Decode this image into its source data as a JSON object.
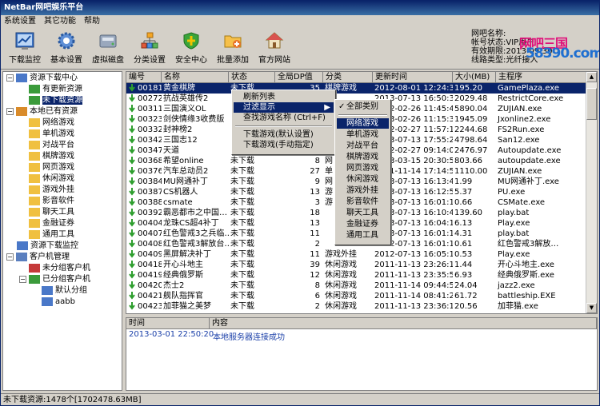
{
  "title": "NetBar网吧娱乐平台",
  "menu": [
    "系统设置",
    "其它功能",
    "帮助"
  ],
  "toolbar": [
    {
      "label": "下载监控",
      "icon": "chart-icon"
    },
    {
      "label": "基本设置",
      "icon": "gear-icon"
    },
    {
      "label": "虚拟磁盘",
      "icon": "disk-icon"
    },
    {
      "label": "分类设置",
      "icon": "category-icon"
    },
    {
      "label": "安全中心",
      "icon": "shield-icon"
    },
    {
      "label": "批量添加",
      "icon": "folder-add-icon"
    },
    {
      "label": "官方网站",
      "icon": "home-icon"
    }
  ],
  "info": {
    "l1": "网吧名称:",
    "l2": "帐号状态:VIP用户",
    "l3": "有效期限:2013-09-30",
    "l4": "线路类型:光纤接入"
  },
  "logo": {
    "l1": "网吧三国",
    "l2": "58390.com"
  },
  "tree": {
    "res_center": "资源下载中心",
    "updated": "有更新资源",
    "not_dl": "未下载资源",
    "local": "本地已有资源",
    "cats": [
      "网络游戏",
      "单机游戏",
      "对战平台",
      "棋牌游戏",
      "网页游戏",
      "休闲游戏",
      "游戏外挂",
      "影音软件",
      "聊天工具",
      "金融证券",
      "通用工具"
    ],
    "dl_monitor": "资源下载监控",
    "client_mgr": "客户机管理",
    "ungrouped": "未分组客户机",
    "grouped": "已分组客户机",
    "default_group": "默认分组",
    "aabb": "aabb"
  },
  "columns": [
    "编号",
    "名称",
    "状态",
    "全局DP值",
    "分类",
    "更新时间",
    "大小(MB)",
    "主程序"
  ],
  "rows": [
    [
      "00181",
      "黄金棋牌",
      "未下载",
      "35",
      "棋牌游戏",
      "2012-08-01 12:24:36",
      "195.20",
      "GamePlaza.exe"
    ],
    [
      "00272",
      "抗战英雄传2",
      "",
      "",
      "",
      "2013-07-13 16:50:30",
      "2029.48",
      "RestrictCore.exe"
    ],
    [
      "00311",
      "三国演义OL",
      "",
      "",
      "",
      "2012-02-26 11:45:41",
      "5890.04",
      "ZUJIAN.exe"
    ],
    [
      "00323",
      "剑侠情缘3收费版",
      "",
      "",
      "",
      "2013-02-26 11:15:38",
      "1945.09",
      "Jxonline2.exe"
    ],
    [
      "00332",
      "封神榜2",
      "",
      "",
      "",
      "2012-02-27 11:57:13",
      "2244.68",
      "FS2Run.exe"
    ],
    [
      "00342",
      "三国志12",
      "",
      "",
      "",
      "2013-07-13 17:55:22",
      "4798.64",
      "San12.exe"
    ],
    [
      "00347",
      "天道",
      "",
      "",
      "",
      "2012-02-27 09:14:02",
      "2476.97",
      "Autoupdate.exe"
    ],
    [
      "00368",
      "希望online",
      "未下载",
      "8",
      "网",
      "2013-03-15 20:30:54",
      "803.66",
      "autoupdate.exe"
    ],
    [
      "00376",
      "汽车总动员2",
      "未下载",
      "27",
      "单",
      "2011-11-14 17:14:56",
      "1110.00",
      "ZUJIAN.exe"
    ],
    [
      "00384",
      "MU网通补丁",
      "未下载",
      "9",
      "网",
      "2013-07-13 16:13:49",
      "1.99",
      "MU网通补丁.exe"
    ],
    [
      "00387",
      "CS机器人",
      "未下载",
      "13",
      "游",
      "2013-07-13 16:12:59",
      "5.37",
      "PU.exe"
    ],
    [
      "00388",
      "csmate",
      "未下载",
      "3",
      "游",
      "2013-07-13 16:01:12",
      "0.66",
      "CSMate.exe"
    ],
    [
      "00392",
      "霸恶都市之中国…",
      "未下载",
      "18",
      "",
      "2013-07-13 16:10:48",
      "139.60",
      "play.bat"
    ],
    [
      "00404",
      "龙珠CS超4补丁",
      "未下载",
      "13",
      "",
      "2013-07-13 16:04:17",
      "6.13",
      "Play.exe"
    ],
    [
      "00407",
      "红色警戒3之兵临…",
      "未下载",
      "11",
      "",
      "2013-07-13 16:01:15",
      "4.31",
      "play.bat"
    ],
    [
      "00408",
      "红色警戒3解放台…",
      "未下载",
      "2",
      "",
      "2012-07-13 16:01:18",
      "0.61",
      "红色警戒3解放…"
    ],
    [
      "00409",
      "黑屏解决补丁",
      "未下载",
      "11",
      "游戏外挂",
      "2012-07-13 16:05:11",
      "0.53",
      "Play.exe"
    ],
    [
      "00418",
      "开心斗地主",
      "未下载",
      "39",
      "休闲游戏",
      "2011-11-13 23:26:18",
      "1.44",
      "开心斗地主.exe"
    ],
    [
      "00419",
      "经典俄罗斯",
      "未下载",
      "12",
      "休闲游戏",
      "2011-11-13 23:35:52",
      "6.93",
      "经典俄罗斯.exe"
    ],
    [
      "00420",
      "杰士2",
      "未下载",
      "8",
      "休闲游戏",
      "2011-11-14 09:44:51",
      "24.04",
      "jazz2.exe"
    ],
    [
      "00421",
      "舰队指挥官",
      "未下载",
      "6",
      "休闲游戏",
      "2011-11-14 08:41:28",
      "61.72",
      "battleship.EXE"
    ],
    [
      "00423",
      "加菲猫之美梦",
      "未下载",
      "2",
      "休闲游戏",
      "2011-11-13 23:36:11",
      "20.56",
      "加菲猫.exe"
    ]
  ],
  "context_menu": [
    "刷新列表",
    "过滤显示",
    "查找游戏名称 (Ctrl+F)",
    "下载游戏(默认设置)",
    "下载游戏(手动指定)"
  ],
  "submenu": [
    "全部类别",
    "网络游戏",
    "单机游戏",
    "对战平台",
    "棋牌游戏",
    "网页游戏",
    "休闲游戏",
    "游戏外挂",
    "影音软件",
    "聊天工具",
    "金融证券",
    "通用工具"
  ],
  "log": {
    "h_time": "时间",
    "h_content": "内容",
    "time": "2013-03-01 22:50:20",
    "content": "本地服务器连接成功"
  },
  "status": "未下载资源:1478个[1702478.63MB]"
}
